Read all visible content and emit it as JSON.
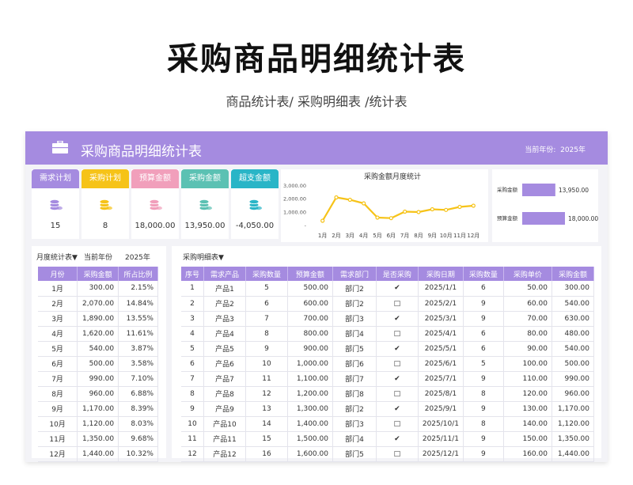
{
  "header": {
    "title": "采购商品明细统计表",
    "subtitle": "商品统计表/ 采购明细表 /统计表"
  },
  "banner": {
    "title": "采购商品明细统计表",
    "year_label": "当前年份",
    "year_value": "2025年"
  },
  "kpis": [
    {
      "label": "需求计划",
      "value": "15",
      "color": "#a58be0"
    },
    {
      "label": "采购计划",
      "value": "8",
      "color": "#f6c318"
    },
    {
      "label": "预算金额",
      "value": "18,000.00",
      "color": "#f19fbb"
    },
    {
      "label": "采购金额",
      "value": "13,950.00",
      "color": "#5bc1b3"
    },
    {
      "label": "超支金额",
      "value": "-4,050.00",
      "color": "#29b5c7"
    }
  ],
  "chart_data": {
    "type": "line",
    "title": "采购金额月度统计",
    "categories": [
      "1月",
      "2月",
      "3月",
      "4月",
      "5月",
      "6月",
      "7月",
      "8月",
      "9月",
      "10月",
      "11月",
      "12月"
    ],
    "values": [
      300,
      2070,
      1890,
      1620,
      540,
      500,
      990,
      960,
      1170,
      1120,
      1350,
      1440
    ],
    "ylim": [
      0,
      3000
    ],
    "yticks": [
      "-",
      "1,000.00",
      "2,000.00",
      "3,000.00"
    ],
    "color": "#f6c318",
    "grid": false
  },
  "bars": {
    "items": [
      {
        "label": "采购金额",
        "value": 13950,
        "display": "13,950.00"
      },
      {
        "label": "预算金额",
        "value": 18000,
        "display": "18,000.00"
      }
    ],
    "color": "#a58be0"
  },
  "monthly": {
    "title": "月度统计表▼",
    "year_label": "当前年份",
    "year_value": "2025年",
    "columns": [
      "月份",
      "采购金额",
      "所占比例"
    ],
    "rows": [
      [
        "1月",
        "300.00",
        "2.15%"
      ],
      [
        "2月",
        "2,070.00",
        "14.84%"
      ],
      [
        "3月",
        "1,890.00",
        "13.55%"
      ],
      [
        "4月",
        "1,620.00",
        "11.61%"
      ],
      [
        "5月",
        "540.00",
        "3.87%"
      ],
      [
        "6月",
        "500.00",
        "3.58%"
      ],
      [
        "7月",
        "990.00",
        "7.10%"
      ],
      [
        "8月",
        "960.00",
        "6.88%"
      ],
      [
        "9月",
        "1,170.00",
        "8.39%"
      ],
      [
        "10月",
        "1,120.00",
        "8.03%"
      ],
      [
        "11月",
        "1,350.00",
        "9.68%"
      ],
      [
        "12月",
        "1,440.00",
        "10.32%"
      ]
    ]
  },
  "detail": {
    "title": "采购明细表▼",
    "columns": [
      "序号",
      "需求产品",
      "采购数量",
      "预算金额",
      "需求部门",
      "是否采购",
      "采购日期",
      "采购数量",
      "采购单价",
      "采购金额"
    ],
    "rows": [
      [
        "1",
        "产品1",
        "5",
        "500.00",
        "部门2",
        "✔",
        "2025/1/1",
        "6",
        "50.00",
        "300.00"
      ],
      [
        "2",
        "产品2",
        "6",
        "600.00",
        "部门2",
        "□",
        "2025/2/1",
        "9",
        "60.00",
        "540.00"
      ],
      [
        "3",
        "产品3",
        "7",
        "700.00",
        "部门3",
        "✔",
        "2025/3/1",
        "9",
        "70.00",
        "630.00"
      ],
      [
        "4",
        "产品4",
        "8",
        "800.00",
        "部门4",
        "□",
        "2025/4/1",
        "6",
        "80.00",
        "480.00"
      ],
      [
        "5",
        "产品5",
        "9",
        "900.00",
        "部门5",
        "✔",
        "2025/5/1",
        "6",
        "90.00",
        "540.00"
      ],
      [
        "6",
        "产品6",
        "10",
        "1,000.00",
        "部门6",
        "□",
        "2025/6/1",
        "5",
        "100.00",
        "500.00"
      ],
      [
        "7",
        "产品7",
        "11",
        "1,100.00",
        "部门7",
        "✔",
        "2025/7/1",
        "9",
        "110.00",
        "990.00"
      ],
      [
        "8",
        "产品8",
        "12",
        "1,200.00",
        "部门8",
        "□",
        "2025/8/1",
        "8",
        "120.00",
        "960.00"
      ],
      [
        "9",
        "产品9",
        "13",
        "1,300.00",
        "部门2",
        "✔",
        "2025/9/1",
        "9",
        "130.00",
        "1,170.00"
      ],
      [
        "10",
        "产品10",
        "14",
        "1,400.00",
        "部门3",
        "□",
        "2025/10/1",
        "8",
        "140.00",
        "1,120.00"
      ],
      [
        "11",
        "产品11",
        "15",
        "1,500.00",
        "部门4",
        "✔",
        "2025/11/1",
        "9",
        "150.00",
        "1,350.00"
      ],
      [
        "12",
        "产品12",
        "16",
        "1,600.00",
        "部门5",
        "□",
        "2025/12/1",
        "9",
        "160.00",
        "1,440.00"
      ]
    ]
  }
}
